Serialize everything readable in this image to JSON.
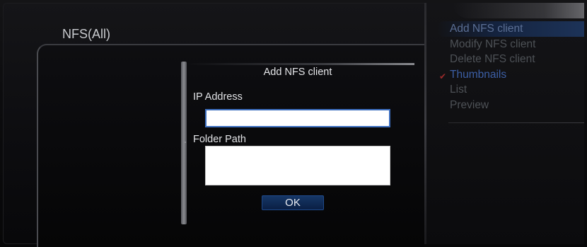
{
  "screen": {
    "title": "NFS(All)"
  },
  "dialog": {
    "title": "Add NFS client",
    "ip_label": "IP Address",
    "ip_value": "",
    "folder_label": "Folder Path",
    "folder_value": "",
    "ok_label": "OK"
  },
  "menu": {
    "items": [
      {
        "label": "Add NFS client",
        "state": "highlighted"
      },
      {
        "label": "Modify NFS client",
        "state": "normal"
      },
      {
        "label": "Delete NFS client",
        "state": "normal"
      },
      {
        "label": "Thumbnails",
        "state": "selected",
        "marker": "check-mark-icon"
      },
      {
        "label": "List",
        "state": "normal"
      },
      {
        "label": "Preview",
        "state": "normal"
      }
    ]
  },
  "colors": {
    "background": "#0c0c0e",
    "highlight": "#1d3358",
    "selected_text": "#3c5fa6",
    "menu_text": "#4d5156",
    "input_focus_border": "#3d6fbf",
    "ok_button": "#0f2a55",
    "marker": "#9b2a2a"
  }
}
